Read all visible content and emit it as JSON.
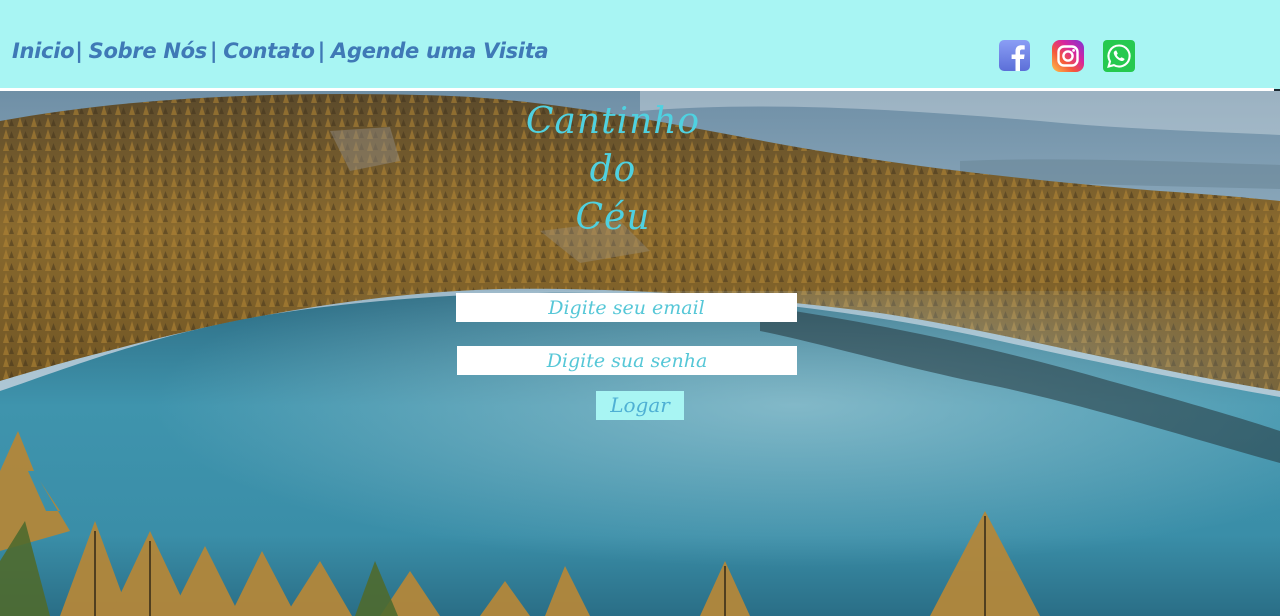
{
  "nav": {
    "items": [
      {
        "label": "Inicio"
      },
      {
        "label": "Sobre Nós"
      },
      {
        "label": "Contato"
      },
      {
        "label": "Agende uma Visita"
      }
    ],
    "separator": "|"
  },
  "social": {
    "facebook": {
      "icon": "facebook-icon",
      "color": "#6f86ec"
    },
    "instagram": {
      "icon": "instagram-icon",
      "color": "#e1306c"
    },
    "whatsapp": {
      "icon": "whatsapp-icon",
      "color": "#25d366"
    }
  },
  "title": {
    "line1": "Cantinho",
    "line2": "do",
    "line3": "Céu",
    "color": "#4fd1e0"
  },
  "login": {
    "email_placeholder": "Digite seu email",
    "password_placeholder": "Digite sua senha",
    "button_label": "Logar"
  },
  "colors": {
    "header_bg": "#a8f5f3",
    "nav_text": "#3f79b6",
    "button_bg": "#a8f5f3"
  }
}
